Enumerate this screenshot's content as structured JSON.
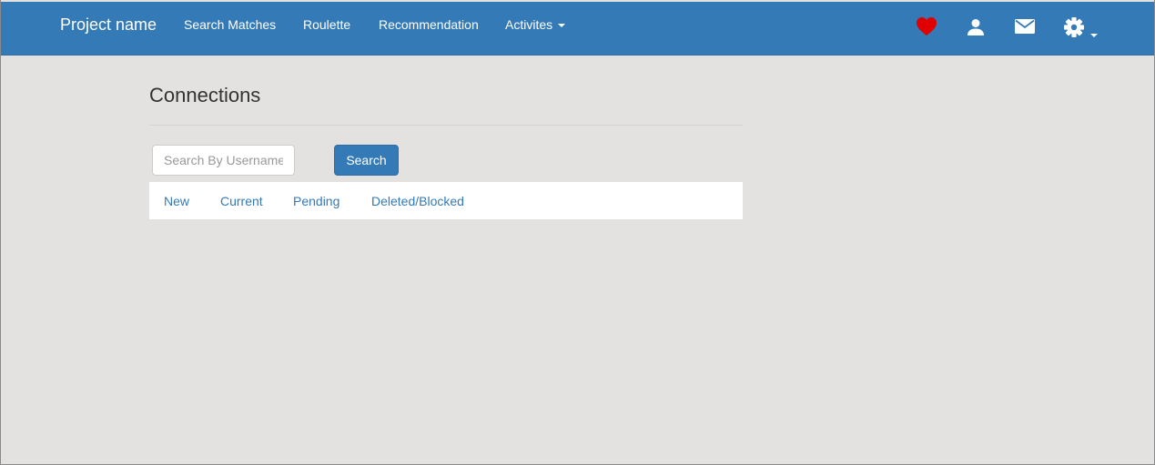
{
  "navbar": {
    "brand": "Project name",
    "links": [
      {
        "label": "Search Matches"
      },
      {
        "label": "Roulette"
      },
      {
        "label": "Recommendation"
      },
      {
        "label": "Activites"
      }
    ],
    "icons": [
      "heart-icon",
      "user-icon",
      "envelope-icon",
      "gear-icon"
    ],
    "colors": {
      "background": "#337ab7",
      "heart": "#e00000",
      "text": "#ffffff"
    }
  },
  "main": {
    "title": "Connections",
    "search": {
      "placeholder": "Search By Username",
      "value": "",
      "button_label": "Search"
    },
    "tabs": [
      {
        "label": "New"
      },
      {
        "label": "Current"
      },
      {
        "label": "Pending"
      },
      {
        "label": "Deleted/Blocked"
      }
    ],
    "colors": {
      "background": "#e3e2e1",
      "link": "#337ab7"
    }
  }
}
